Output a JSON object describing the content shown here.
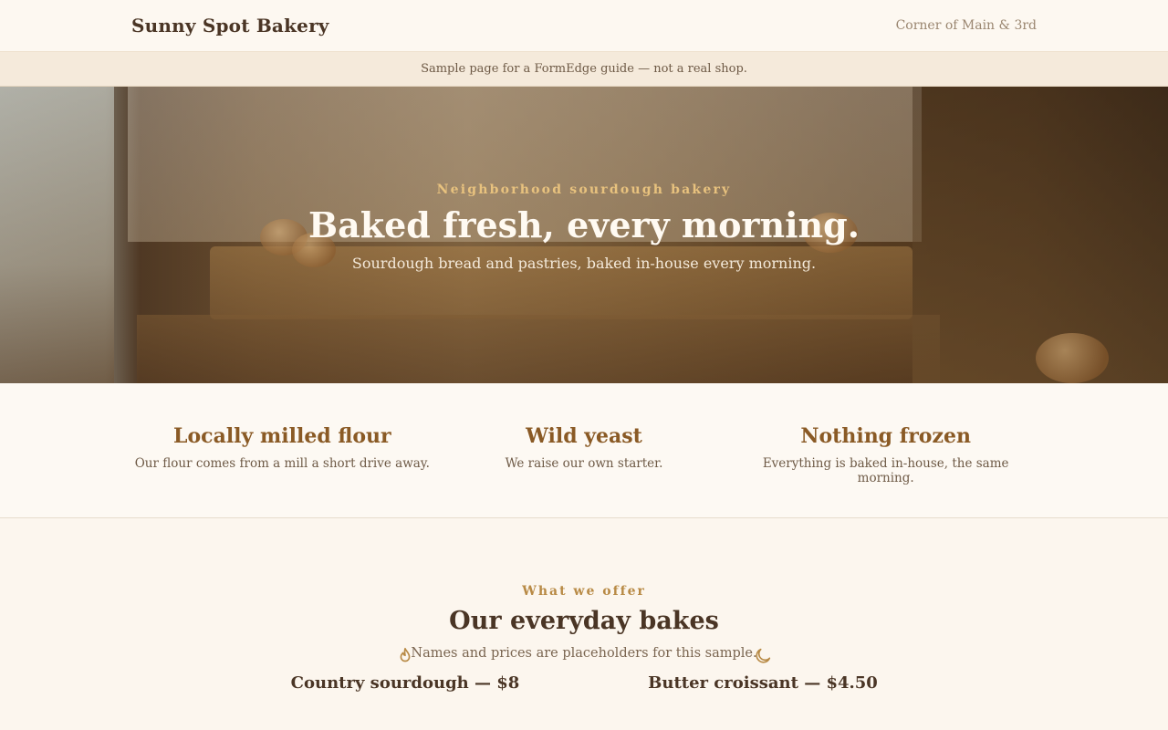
{
  "header": {
    "brand": "Sunny Spot Bakery",
    "location": "Corner of Main & 3rd"
  },
  "notice": "Sample page for a FormEdge guide — not a real shop.",
  "hero": {
    "eyebrow": "Neighborhood sourdough bakery",
    "title": "Baked fresh, every morning.",
    "subtitle": "Sourdough bread and pastries, baked in-house every morning."
  },
  "features": [
    {
      "title": "Locally milled flour",
      "text": "Our flour comes from a mill a short drive away."
    },
    {
      "title": "Wild yeast",
      "text": "We raise our own starter."
    },
    {
      "title": "Nothing frozen",
      "text": "Everything is baked in-house, the same morning."
    }
  ],
  "offer": {
    "eyebrow": "What we offer",
    "title": "Our everyday bakes",
    "subtitle": "Names and prices are placeholders for this sample."
  },
  "products": [
    {
      "name": "Country sourdough — $8",
      "icon": "flame-icon"
    },
    {
      "name": "Butter croissant — $4.50",
      "icon": "moon-icon"
    }
  ],
  "colors": {
    "accent": "#b88a45",
    "feature_heading": "#8a5a25",
    "text": "#4a3525",
    "background": "#fcf6ee"
  }
}
